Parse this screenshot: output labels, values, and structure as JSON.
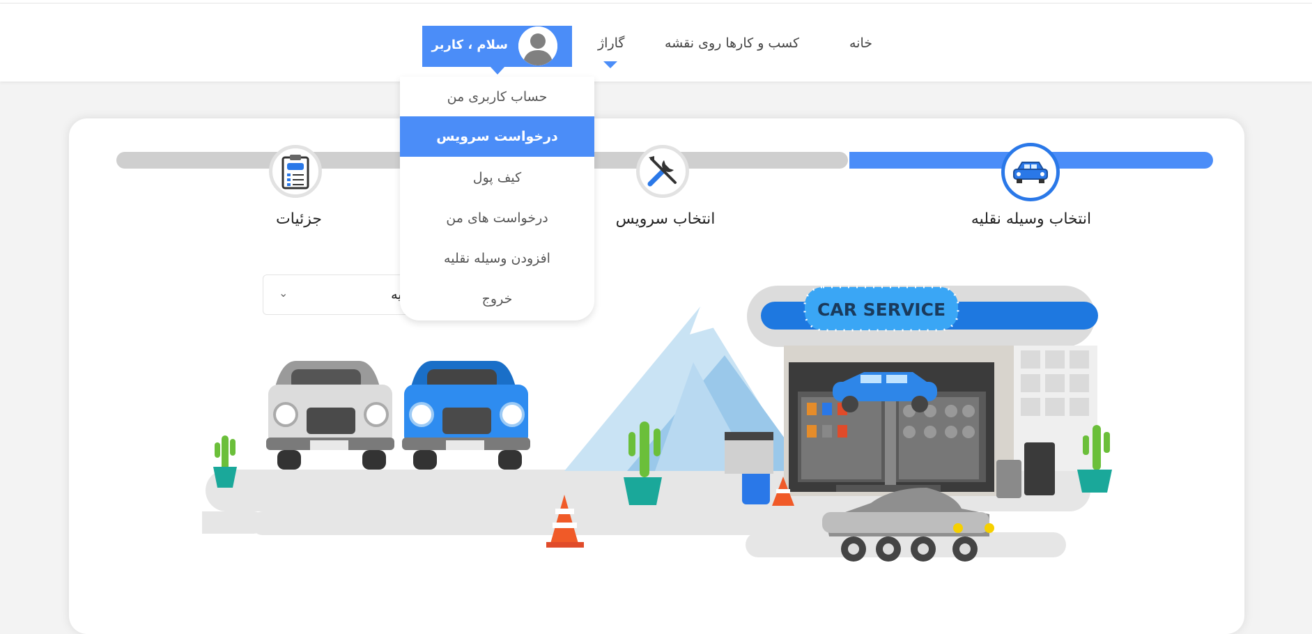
{
  "nav": {
    "home": "خانه",
    "map": "کسب و کارها روی نقشه",
    "garage": "گاراژ",
    "user_greeting": "سلام ، کاربر"
  },
  "dropdown": {
    "items": [
      {
        "label": "حساب کاربری من",
        "active": false
      },
      {
        "label": "درخواست سرویس",
        "active": true
      },
      {
        "label": "کیف پول",
        "active": false
      },
      {
        "label": "درخواست های من",
        "active": false
      },
      {
        "label": "افزودن وسیله نقلیه",
        "active": false
      },
      {
        "label": "خروج",
        "active": false
      }
    ]
  },
  "steps": [
    {
      "label": "انتخاب وسیله نقلیه",
      "icon": "car-icon",
      "active": true
    },
    {
      "label": "انتخاب سرویس",
      "icon": "tools-icon",
      "active": false
    },
    {
      "label": "جزئیات",
      "icon": "clipboard-icon",
      "active": false
    }
  ],
  "vehicle_select": {
    "value": "انتخاب وسیله نقلیه",
    "visible_value": "یله نقلیه"
  },
  "illustration": {
    "sign_text": "CAR SERVICE"
  },
  "colors": {
    "accent": "#4b8df8",
    "active_ring": "#2a78e8",
    "track": "#cfcfcf"
  }
}
